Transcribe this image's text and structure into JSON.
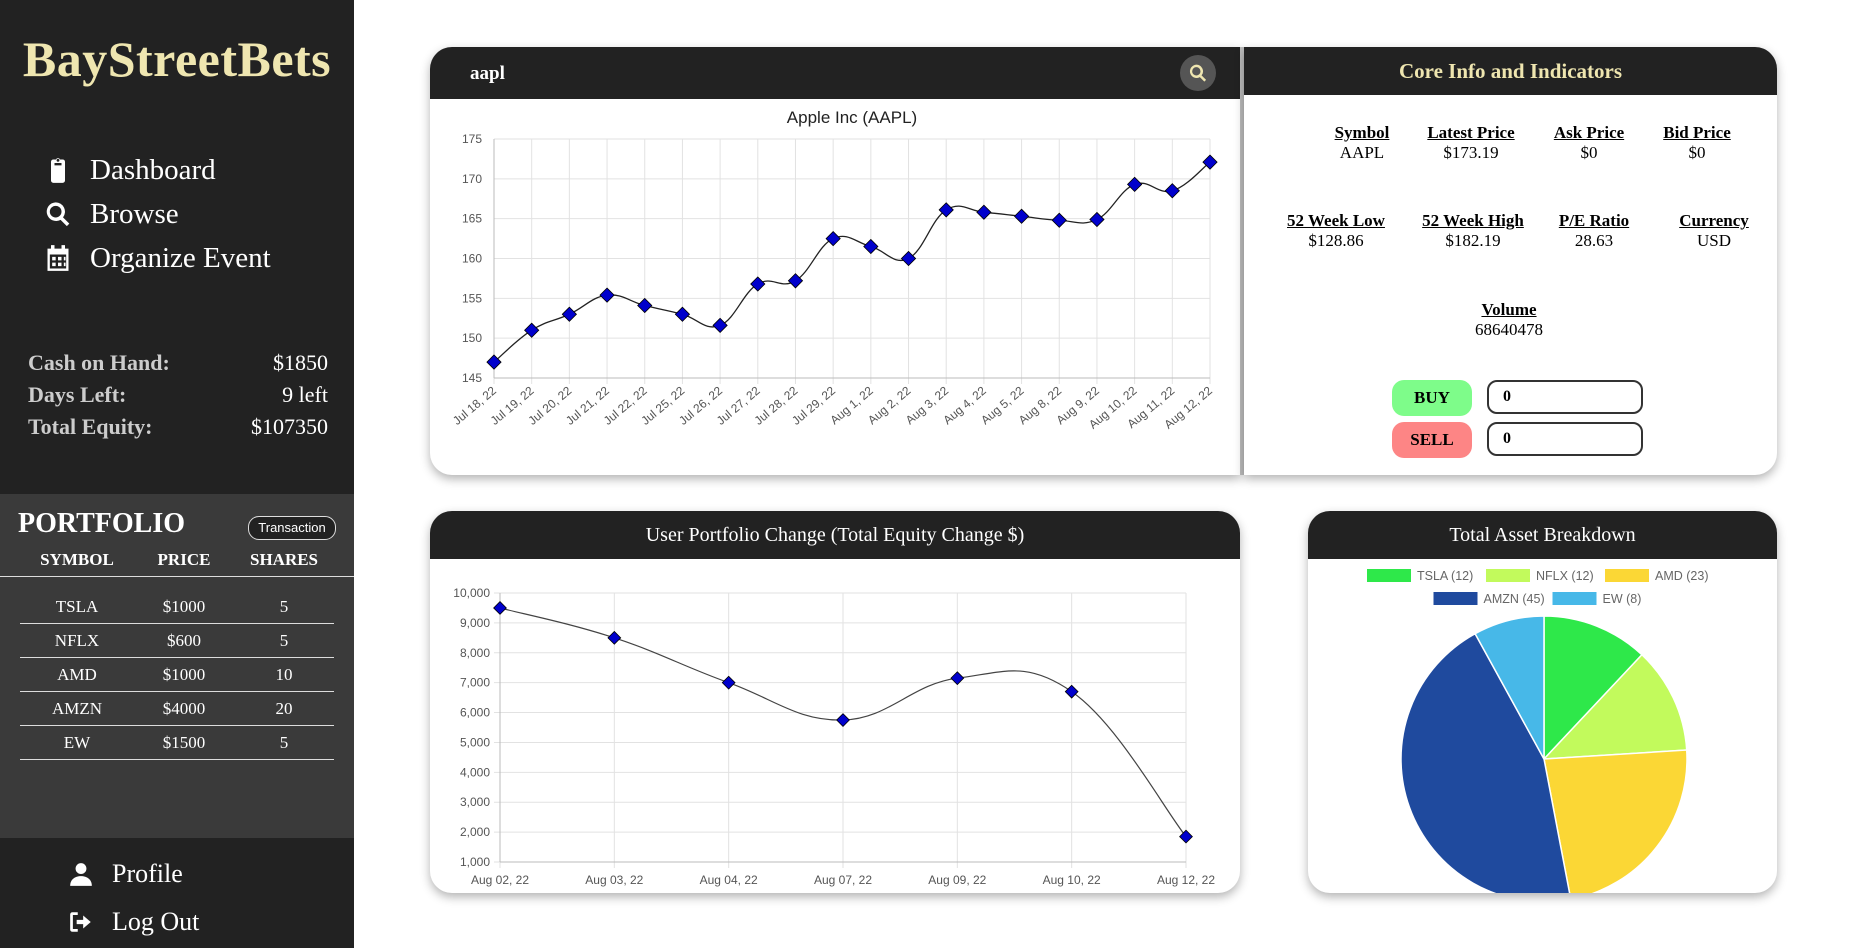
{
  "brand": "BayStreetBets",
  "nav": {
    "dashboard": "Dashboard",
    "browse": "Browse",
    "organize": "Organize Event",
    "profile": "Profile",
    "logout": "Log Out"
  },
  "stats": {
    "cash_label": "Cash on Hand:",
    "cash_value": "$1850",
    "days_label": "Days Left:",
    "days_value": "9 left",
    "equity_label": "Total Equity:",
    "equity_value": "$107350"
  },
  "portfolio": {
    "title": "PORTFOLIO",
    "transaction_label": "Transaction",
    "headers": {
      "symbol": "SYMBOL",
      "price": "PRICE",
      "shares": "SHARES"
    },
    "rows": [
      {
        "symbol": "TSLA",
        "price": "$1000",
        "shares": "5"
      },
      {
        "symbol": "NFLX",
        "price": "$600",
        "shares": "5"
      },
      {
        "symbol": "AMD",
        "price": "$1000",
        "shares": "10"
      },
      {
        "symbol": "AMZN",
        "price": "$4000",
        "shares": "20"
      },
      {
        "symbol": "EW",
        "price": "$1500",
        "shares": "5"
      }
    ]
  },
  "search": {
    "value": "aapl"
  },
  "info": {
    "title": "Core Info and Indicators",
    "symbol_label": "Symbol",
    "symbol_value": "AAPL",
    "latest_label": "Latest Price",
    "latest_value": "$173.19",
    "ask_label": "Ask Price",
    "ask_value": "$0",
    "bid_label": "Bid Price",
    "bid_value": "$0",
    "low52_label": "52 Week Low",
    "low52_value": "$128.86",
    "high52_label": "52 Week High",
    "high52_value": "$182.19",
    "pe_label": "P/E Ratio",
    "pe_value": "28.63",
    "currency_label": "Currency",
    "currency_value": "USD",
    "volume_label": "Volume",
    "volume_value": "68640478",
    "buy_label": "BUY",
    "sell_label": "SELL",
    "buy_qty": "0",
    "sell_qty": "0"
  },
  "equity_card": {
    "title": "User Portfolio Change (Total Equity Change $)"
  },
  "asset_card": {
    "title": "Total Asset Breakdown"
  },
  "chart_data": [
    {
      "type": "line",
      "title": "Apple Inc (AAPL)",
      "x": [
        "Jul 18, 22",
        "Jul 19, 22",
        "Jul 20, 22",
        "Jul 21, 22",
        "Jul 22, 22",
        "Jul 25, 22",
        "Jul 26, 22",
        "Jul 27, 22",
        "Jul 28, 22",
        "Jul 29, 22",
        "Aug 1, 22",
        "Aug 2, 22",
        "Aug 3, 22",
        "Aug 4, 22",
        "Aug 5, 22",
        "Aug 8, 22",
        "Aug 9, 22",
        "Aug 10, 22",
        "Aug 11, 22",
        "Aug 12, 22"
      ],
      "values": [
        147,
        151,
        153,
        155.4,
        154.1,
        153,
        151.6,
        156.8,
        157.2,
        162.5,
        161.5,
        160,
        166.1,
        165.8,
        165.3,
        164.8,
        164.9,
        169.3,
        168.5,
        172.1
      ],
      "ylim": [
        145,
        175
      ],
      "yticks": [
        175,
        170,
        165,
        160,
        155,
        150,
        145
      ],
      "grid": true,
      "colors": {
        "line": "#222222",
        "marker": "#0000cc"
      }
    },
    {
      "type": "line",
      "title": "",
      "x": [
        "Aug 02, 22",
        "Aug 03, 22",
        "Aug 04, 22",
        "Aug 07, 22",
        "Aug 09, 22",
        "Aug 10, 22",
        "Aug 12, 22"
      ],
      "values": [
        9500,
        8500,
        7000,
        5750,
        7150,
        6700,
        1850
      ],
      "ylim": [
        1000,
        10000
      ],
      "yticks": [
        "10,000",
        "9,000",
        "8,000",
        "7,000",
        "6,000",
        "5,000",
        "4,000",
        "3,000",
        "2,000",
        "1,000"
      ],
      "grid": true,
      "colors": {
        "line": "#444444",
        "marker": "#0000cc"
      }
    },
    {
      "type": "pie",
      "legend": "top",
      "slices": [
        {
          "name": "TSLA (12)",
          "value": 12,
          "color": "#2ee84a"
        },
        {
          "name": "NFLX (12)",
          "value": 12,
          "color": "#c2fa5c"
        },
        {
          "name": "AMD (23)",
          "value": 23,
          "color": "#fbd735"
        },
        {
          "name": "AMZN (45)",
          "value": 45,
          "color": "#1f4a9e"
        },
        {
          "name": "EW (8)",
          "value": 8,
          "color": "#47b8e8"
        }
      ]
    }
  ]
}
